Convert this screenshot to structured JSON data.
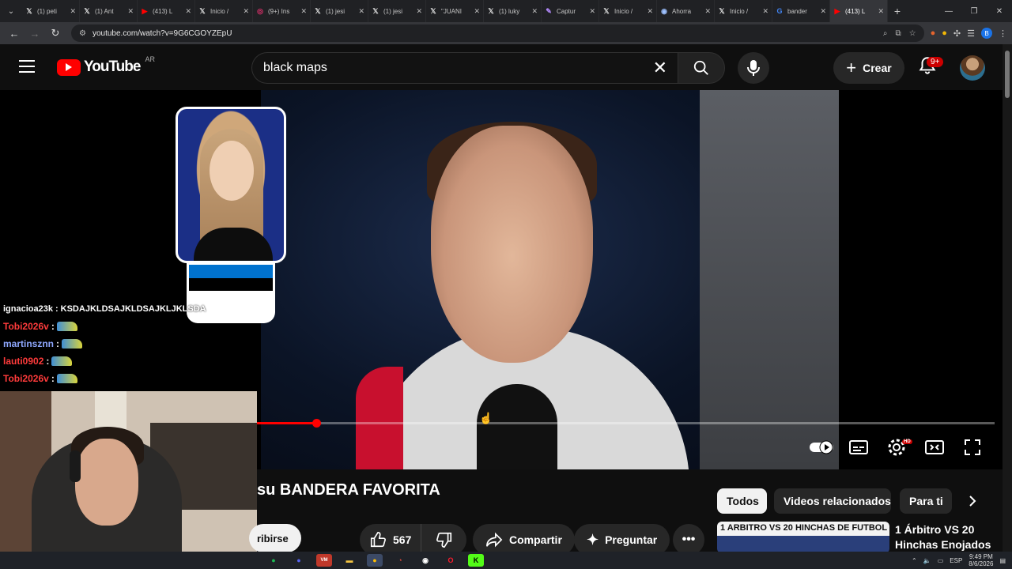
{
  "browser": {
    "tabs": [
      {
        "label": "(1) peti",
        "icon": "x-icon"
      },
      {
        "label": "(1) Ant",
        "icon": "x-icon"
      },
      {
        "label": "(413) L",
        "icon": "youtube-icon"
      },
      {
        "label": "Inicio /",
        "icon": "x-icon"
      },
      {
        "label": "(9+) Ins",
        "icon": "instagram-icon"
      },
      {
        "label": "(1) jesi",
        "icon": "x-icon"
      },
      {
        "label": "(1) jesi",
        "icon": "x-icon"
      },
      {
        "label": "\"JUANI",
        "icon": "x-icon"
      },
      {
        "label": "(1) luky",
        "icon": "x-icon"
      },
      {
        "label": "Captur",
        "icon": "pen-icon"
      },
      {
        "label": "Inicio /",
        "icon": "x-icon"
      },
      {
        "label": "Ahorra",
        "icon": "steam-icon"
      },
      {
        "label": "Inicio /",
        "icon": "x-icon"
      },
      {
        "label": "bander",
        "icon": "google-icon"
      },
      {
        "label": "(413) L",
        "icon": "youtube-icon"
      }
    ],
    "url": "youtube.com/watch?v=9G6CGOYZEpU"
  },
  "youtube": {
    "logo_text": "YouTube",
    "country": "AR",
    "search_value": "black maps",
    "create_label": "Crear",
    "notification_count": "9+",
    "video_title": "su BANDERA FAVORITA",
    "subscribe_label": "ribirse",
    "likes": "567",
    "share_label": "Compartir",
    "ask_label": "Preguntar",
    "progress": 0.08,
    "chips": [
      "Todos",
      "Videos relacionados",
      "Para ti"
    ],
    "recommendation": {
      "thumb_text": "1 ARBITRO VS 20 HINCHAS DE FUTBOL",
      "title": "1 Árbitro VS 20 Hinchas Enojados"
    }
  },
  "overlay": {
    "chat": [
      {
        "user": "ignacioa23k",
        "message": "KSDAJKLDSAJKLDSAJKLJKLSDA",
        "color": "#ffffff"
      },
      {
        "user": "Tobi2026v",
        "message": "",
        "color": "#ff3b3b"
      },
      {
        "user": "martinsznn",
        "message": "",
        "color": "#8fa8ff"
      },
      {
        "user": "lauti0902",
        "message": "",
        "color": "#ff3b3b"
      },
      {
        "user": "Tobi2026v",
        "message": "",
        "color": "#ff3b3b"
      }
    ],
    "flag_colors": [
      "#0072ce",
      "#000000",
      "#ffffff"
    ]
  },
  "taskbar": {
    "language": "ESP",
    "time": "9:49 PM",
    "date": "8/6/2026"
  },
  "colors": {
    "youtube_red": "#ff0000",
    "background": "#0f0f0f",
    "pill": "#272727"
  }
}
